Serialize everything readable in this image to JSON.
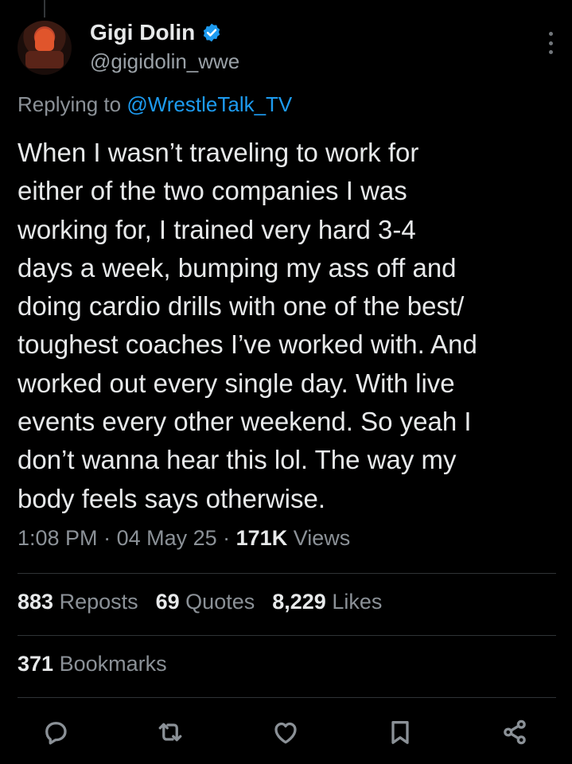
{
  "author": {
    "display_name": "Gigi Dolin",
    "handle": "@gigidolin_wwe",
    "verified": true,
    "verified_color": "#1d9bf0"
  },
  "reply": {
    "prefix": "Replying to ",
    "mention": "@WrestleTalk_TV"
  },
  "tweet": {
    "text": "When I wasn’t traveling to work for\neither of the two companies I was\nworking for, I trained very hard 3-4\ndays a week, bumping my ass off and\ndoing cardio drills with one of the best/\ntoughest coaches I’ve worked with. And\nworked out every single day. With live\nevents every other weekend. So yeah I\ndon’t wanna hear this lol. The way my\nbody feels says otherwise."
  },
  "meta": {
    "time": "1:08 PM",
    "sep1": " · ",
    "date": "04 May 25",
    "sep2": " · ",
    "views_count": "171K",
    "views_label": " Views"
  },
  "stats": {
    "reposts_count": "883",
    "reposts_label": " Reposts",
    "quotes_count": "69",
    "quotes_label": " Quotes",
    "likes_count": "8,229",
    "likes_label": " Likes",
    "bookmarks_count": "371",
    "bookmarks_label": " Bookmarks"
  },
  "actions": {
    "icons": [
      "reply-icon",
      "repost-icon",
      "like-icon",
      "bookmark-icon",
      "share-icon"
    ]
  },
  "colors": {
    "background": "#000000",
    "text": "#e7e9ea",
    "secondary": "#8b9197",
    "accent": "#1d9bf0"
  }
}
